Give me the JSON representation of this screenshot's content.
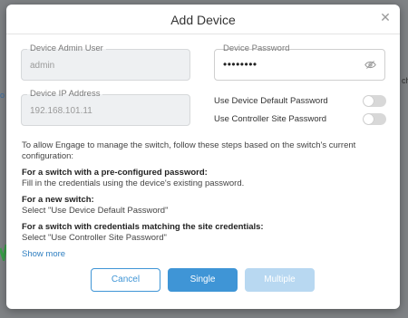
{
  "background": {
    "left_snippet": "o",
    "right_snippet": "ch"
  },
  "modal": {
    "title": "Add Device",
    "close_glyph": "✕"
  },
  "fields": {
    "admin_user": {
      "label": "Device Admin User",
      "value": "admin"
    },
    "password": {
      "label": "Device Password",
      "value": "••••••••"
    },
    "ip_address": {
      "label": "Device IP Address",
      "value": "192.168.101.11"
    }
  },
  "toggles": {
    "default_password": {
      "label": "Use Device Default Password",
      "on": false
    },
    "site_password": {
      "label": "Use Controller Site Password",
      "on": false
    }
  },
  "instructions": {
    "intro": "To allow Engage to manage the switch, follow these steps based on the switch's current configuration:",
    "items": [
      {
        "heading": "For a switch with a pre-configured password:",
        "text": "Fill in the credentials using the device's existing password."
      },
      {
        "heading": "For a new switch:",
        "text": "Select \"Use Device Default Password\""
      },
      {
        "heading": "For a switch with credentials matching the site credentials:",
        "text": "Select \"Use Controller Site Password\""
      }
    ],
    "show_more": "Show more"
  },
  "buttons": {
    "cancel": "Cancel",
    "single": "Single",
    "multiple": "Multiple"
  },
  "colors": {
    "accent": "#3f95d6",
    "accent_disabled": "#b8d8f1",
    "link": "#2f7fc1",
    "overlay": "#7f8285"
  }
}
